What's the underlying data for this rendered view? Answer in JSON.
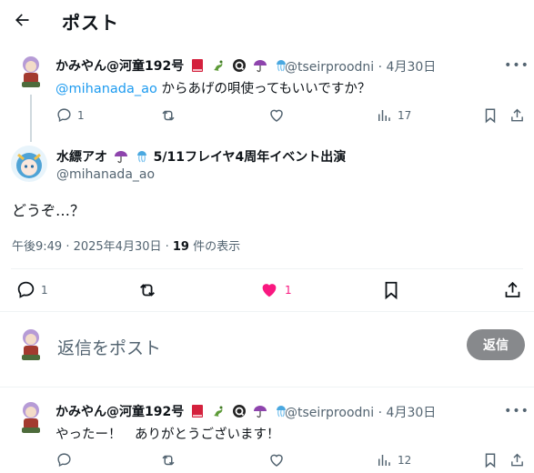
{
  "header": {
    "title": "ポスト"
  },
  "post1": {
    "name": "かみやん@河童192号",
    "handle": "@tseirproodni",
    "sep": "·",
    "date": "4月30日",
    "mention": "@mihanada_ao",
    "text": " からあげの唄使ってもいいですか？",
    "replies": "1",
    "views": "17"
  },
  "main": {
    "name": "水縹アオ",
    "name_suffix": "5/11フレイヤ4周年イベント出演",
    "handle": "@mihanada_ao",
    "text": "どうぞ…？",
    "time": "午後9:49 · 2025年4月30日 · ",
    "views_count": "19",
    "views_label": " 件の表示",
    "replies": "1",
    "likes": "1"
  },
  "reply_box": {
    "placeholder": "返信をポスト",
    "button": "返信"
  },
  "post2": {
    "name": "かみやん@河童192号",
    "handle": "@tseirproodni",
    "sep": "·",
    "date": "4月30日",
    "text": "やったー！　ありがとうございます！",
    "views": "12"
  },
  "colors": {
    "accent": "#1d9bf0",
    "like": "#f91880",
    "muted": "#536471",
    "button_bg": "#87898c"
  }
}
